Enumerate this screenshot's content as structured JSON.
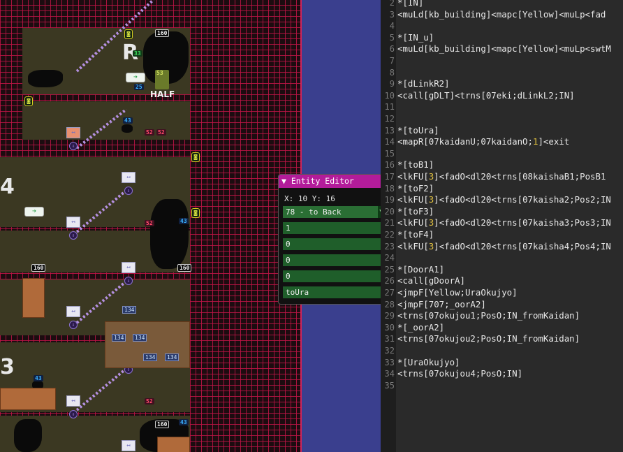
{
  "map": {
    "floor_labels": [
      "R",
      "4",
      "3"
    ],
    "doors": [
      "↤",
      "↤",
      "↤",
      "↤",
      "↤",
      "↤",
      "↤",
      "↤"
    ],
    "badges_blue": [
      "43",
      "43",
      "43",
      "43"
    ],
    "badges_red": [
      "52",
      "52",
      "52",
      "52"
    ],
    "badges_white": [
      "160",
      "160",
      "160",
      "160"
    ],
    "crate_labels": [
      "134",
      "134",
      "134",
      "134",
      "134"
    ],
    "coin_mark": "◙",
    "half_label": "HALF",
    "green_badge": "33",
    "blue_badge2": "25",
    "sign_badge": "53",
    "arrow_label": "➔",
    "down_arrow": "⇩"
  },
  "editor": {
    "title": "▼ Entity Editor",
    "position": "X: 10 Y: 16",
    "select_value": "78 - to Back",
    "dropdown_icon": "▼",
    "fields": [
      "1",
      "0",
      "0",
      "0",
      "toUra"
    ]
  },
  "script": {
    "lines": [
      {
        "n": "2",
        "text": "*[IN]"
      },
      {
        "n": "3",
        "text": "<muLd[kb_building]<mapc[Yellow]<muLp<fad"
      },
      {
        "n": "4",
        "text": ""
      },
      {
        "n": "5",
        "text": "*[IN_u]"
      },
      {
        "n": "6",
        "text": "<muLd[kb_building]<mapc[Yellow]<muLp<swtM"
      },
      {
        "n": "7",
        "text": ""
      },
      {
        "n": "8",
        "text": ""
      },
      {
        "n": "9",
        "text": "*[dLinkR2]"
      },
      {
        "n": "10",
        "text": "<call[gDLT]<trns[07eki;dLinkL2;IN]"
      },
      {
        "n": "11",
        "text": ""
      },
      {
        "n": "12",
        "text": ""
      },
      {
        "n": "13",
        "text": "*[toUra]"
      },
      {
        "n": "14",
        "text": "<mapR[07kaidanU;07kaidanO;1]<exit"
      },
      {
        "n": "15",
        "text": ""
      },
      {
        "n": "16",
        "text": "*[toB1]"
      },
      {
        "n": "17",
        "text": "<lkFU[3]<fadO<dl20<trns[08kaishaB1;PosB1"
      },
      {
        "n": "18",
        "text": "*[toF2]"
      },
      {
        "n": "19",
        "text": "<lkFU[3]<fadO<dl20<trns[07kaisha2;Pos2;IN"
      },
      {
        "n": "20",
        "text": "*[toF3]"
      },
      {
        "n": "21",
        "text": "<lkFU[3]<fadO<dl20<trns[07kaisha3;Pos3;IN"
      },
      {
        "n": "22",
        "text": "*[toF4]"
      },
      {
        "n": "23",
        "text": "<lkFU[3]<fadO<dl20<trns[07kaisha4;Pos4;IN"
      },
      {
        "n": "24",
        "text": ""
      },
      {
        "n": "25",
        "text": "*[DoorA1]"
      },
      {
        "n": "26",
        "text": "<call[gDoorA]"
      },
      {
        "n": "27",
        "text": "<jmpF[Yellow;UraOkujyo]"
      },
      {
        "n": "28",
        "text": "<jmpF[707;_oorA2]"
      },
      {
        "n": "29",
        "text": "<trns[07okujou1;PosO;IN_fromKaidan]"
      },
      {
        "n": "30",
        "text": "*[_oorA2]"
      },
      {
        "n": "31",
        "text": "<trns[07okujou2;PosO;IN_fromKaidan]"
      },
      {
        "n": "32",
        "text": ""
      },
      {
        "n": "33",
        "text": "*[UraOkujyo]"
      },
      {
        "n": "34",
        "text": "<trns[07okujou4;PosO;IN]"
      },
      {
        "n": "35",
        "text": ""
      }
    ]
  }
}
